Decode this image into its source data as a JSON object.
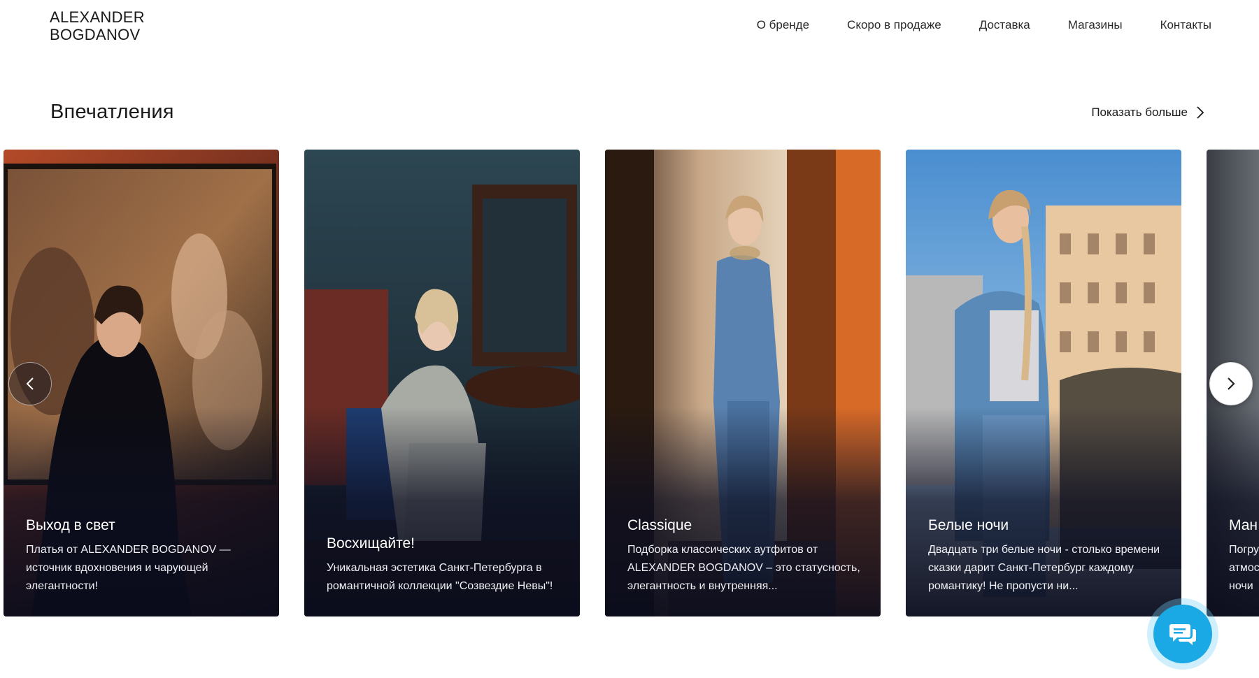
{
  "header": {
    "logo_line1": "ALEXANDER",
    "logo_line2": "BOGDANOV",
    "nav": [
      "О бренде",
      "Скоро в продаже",
      "Доставка",
      "Магазины",
      "Контакты"
    ]
  },
  "section": {
    "title": "Впечатления",
    "show_more": "Показать больше"
  },
  "cards": [
    {
      "title": "Выход в свет",
      "desc": "Платья от ALEXANDER BOGDANOV — источник вдохновения и чарующей элегантности!"
    },
    {
      "title": "Восхищайте!",
      "desc": "Уникальная эстетика Санкт-Петербурга в романтичной коллекции \"Созвездие Невы\"!"
    },
    {
      "title": "Classique",
      "desc": "Подборка классических аутфитов от ALEXANDER BOGDANOV – это статусность, элегантность и внутренняя..."
    },
    {
      "title": "Белые ночи",
      "desc": "Двадцать три белые ночи - столько времени сказки дарит Санкт-Петербург каждому романтику! Не пропусти ни..."
    },
    {
      "title": "Ман",
      "desc": "Погру атмос ночи"
    }
  ],
  "colors": {
    "chat_accent": "#1aa9e4",
    "card_overlay": "#0c0e20"
  }
}
